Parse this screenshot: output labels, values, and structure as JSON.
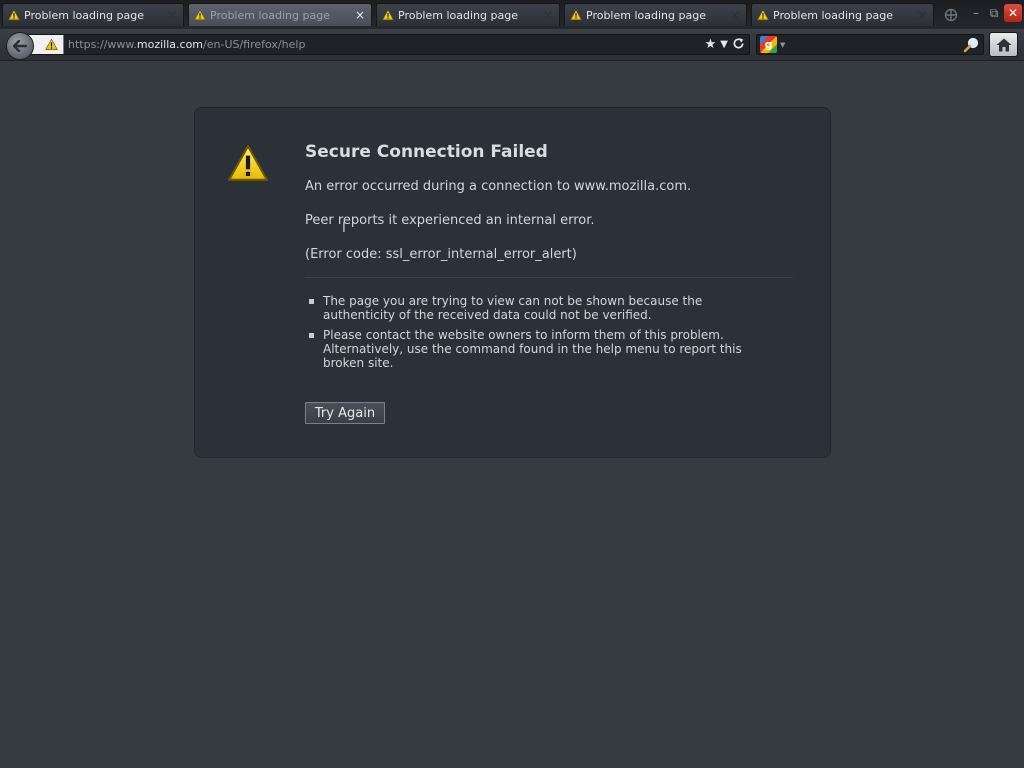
{
  "tabs": [
    {
      "label": "Problem loading page",
      "selected": false
    },
    {
      "label": "Problem loading page",
      "selected": true
    },
    {
      "label": "Problem loading page",
      "selected": false
    },
    {
      "label": "Problem loading page",
      "selected": false
    },
    {
      "label": "Problem loading page",
      "selected": false
    }
  ],
  "tab_close_glyph": "×",
  "window_controls": {
    "minimize": "–",
    "restore": "⧉",
    "close": "✕"
  },
  "address_bar": {
    "url_prefix": "https://www.",
    "url_host": "mozilla.com",
    "url_path": "/en-US/firefox/help"
  },
  "search_bar": {
    "engine_letter": "g",
    "engine": "Google",
    "value": ""
  },
  "error": {
    "title": "Secure Connection Failed",
    "line1": "An error occurred during a connection to www.mozilla.com.",
    "line2": "Peer reports it experienced an internal error.",
    "line3": "(Error code: ssl_error_internal_error_alert)",
    "bullets": [
      "The page you are trying to view can not be shown because the authenticity of the received data could not be verified.",
      "Please contact the website owners to inform them of this problem. Alternatively, use the command found in the help menu to report this broken site."
    ],
    "button": "Try Again"
  },
  "colors": {
    "background": "#363a41",
    "panel": "#2c3038",
    "warning_yellow": "#f5d300",
    "close_red": "#d23b2c"
  },
  "icons": [
    "warning-icon",
    "back-arrow-icon",
    "bookmark-star-icon",
    "dropdown-icon",
    "reload-icon",
    "google-icon",
    "magnifier-icon",
    "home-icon",
    "new-tab-icon"
  ]
}
